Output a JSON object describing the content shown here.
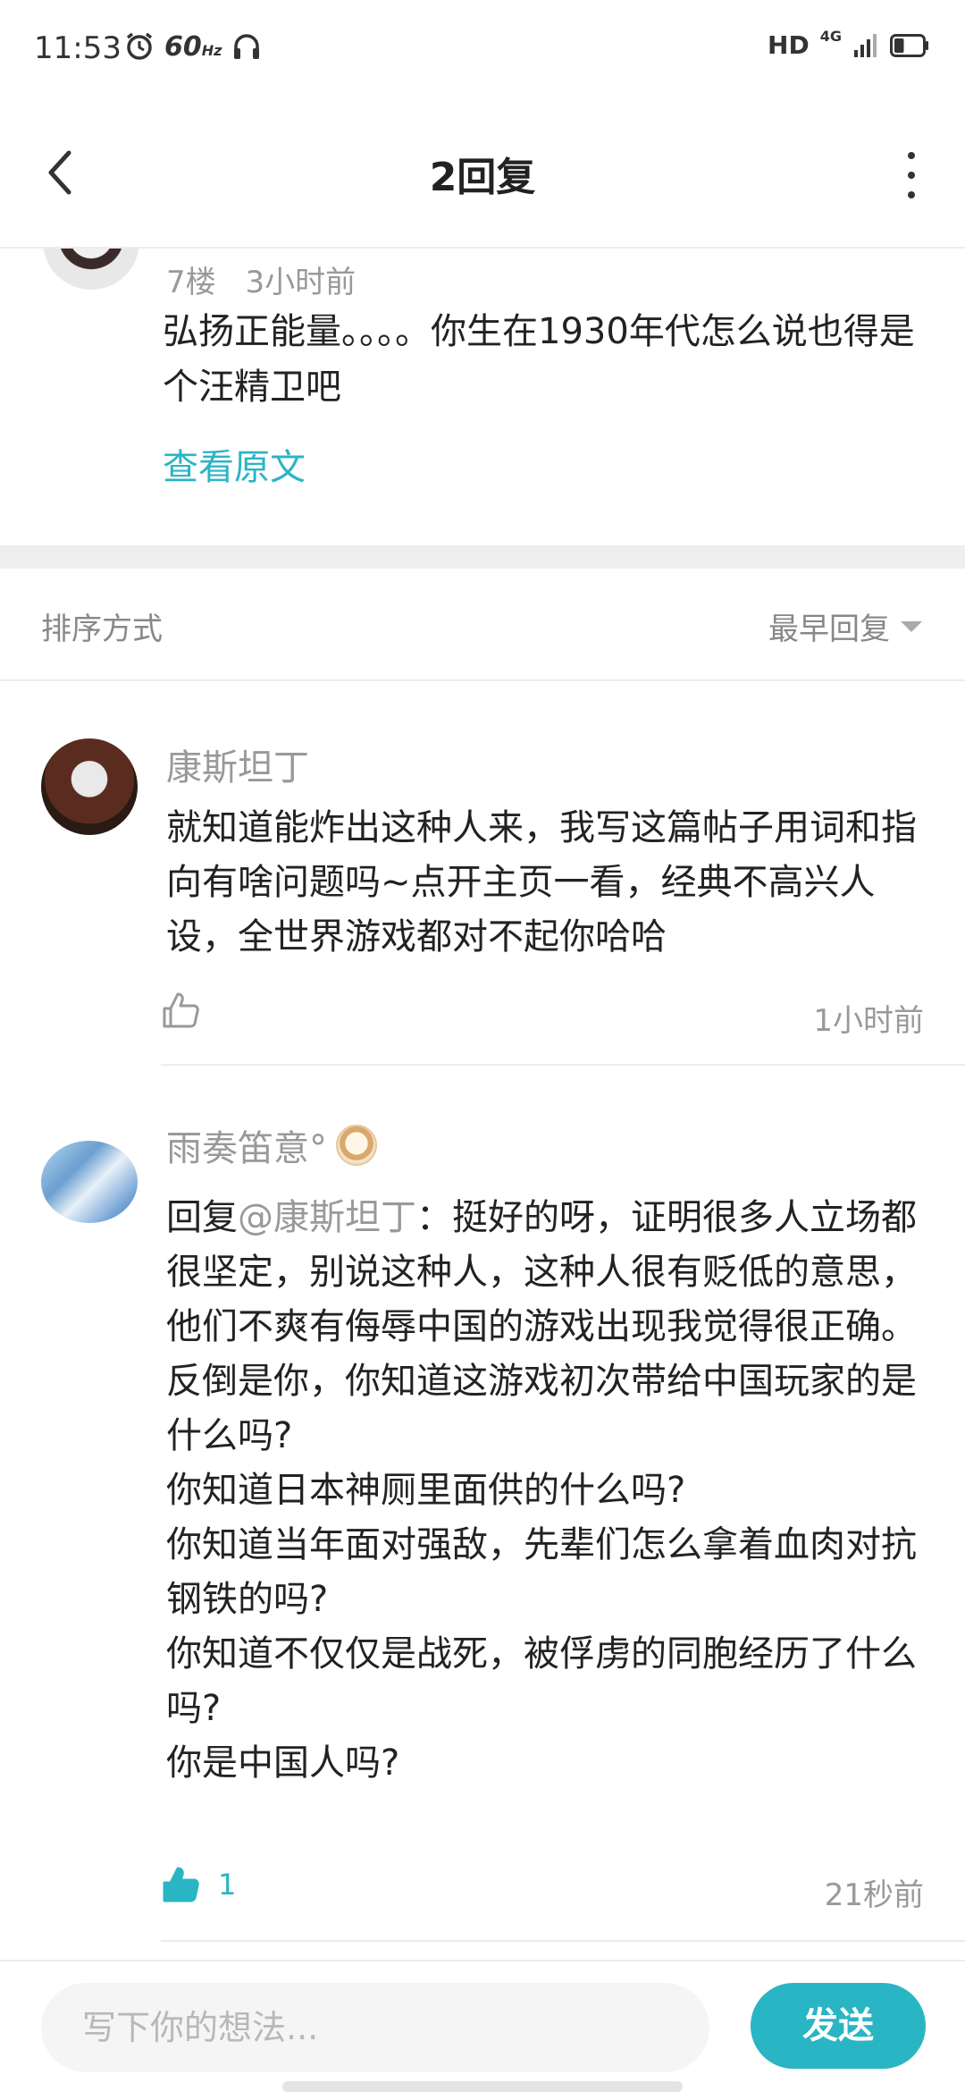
{
  "status_bar": {
    "time": "11:53",
    "refresh_rate": "60",
    "refresh_unit": "Hz",
    "hd": "HD",
    "network": "4G",
    "battery_level": 0.35
  },
  "header": {
    "title": "2回复"
  },
  "original_post": {
    "floor": "7楼",
    "time": "3小时前",
    "text": "弘扬正能量。。。。你生在1930年代怎么说也得是个汪精卫吧",
    "view_original": "查看原文"
  },
  "sort": {
    "label": "排序方式",
    "current": "最早回复"
  },
  "comments": [
    {
      "name": "康斯坦丁",
      "text": "就知道能炸出这种人来，我写这篇帖子用词和指向有啥问题吗~点开主页一看，经典不高兴人设，全世界游戏都对不起你哈哈",
      "likes": "",
      "time": "1小时前"
    },
    {
      "name": "雨奏笛意°",
      "reply_prefix": "回复",
      "mention": "@康斯坦丁",
      "text": "：挺好的呀，证明很多人立场都很坚定，别说这种人，这种人很有贬低的意思，他们不爽有侮辱中国的游戏出现我觉得很正确。\n反倒是你，你知道这游戏初次带给中国玩家的是什么吗?\n你知道日本神厕里面供的什么吗?\n你知道当年面对强敌，先辈们怎么拿着血肉对抗钢铁的吗?\n你知道不仅仅是战死，被俘虏的同胞经历了什么吗?\n你是中国人吗?",
      "likes": "1",
      "time": "21秒前"
    }
  ],
  "input": {
    "placeholder": "写下你的想法...",
    "send_label": "发送"
  },
  "colors": {
    "accent": "#2ab5c4",
    "muted_text": "#999999",
    "divider": "#eeeeee"
  }
}
